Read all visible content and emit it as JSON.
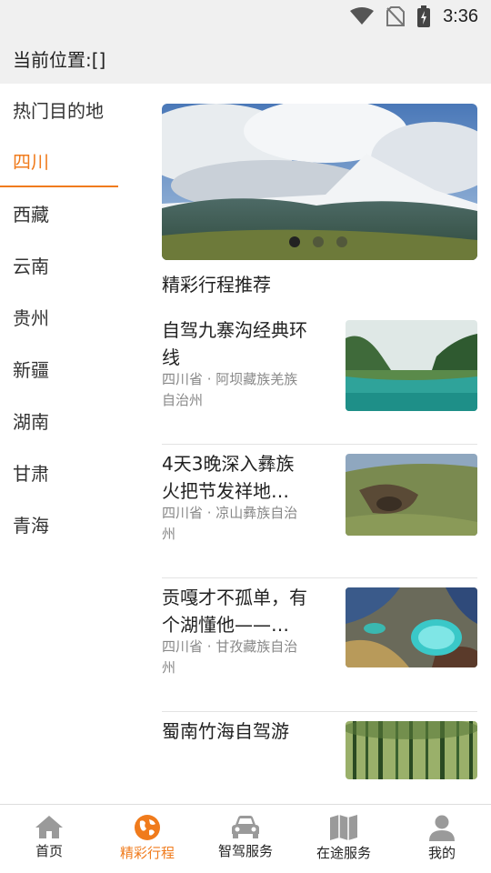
{
  "status_bar": {
    "time": "3:36",
    "icons": [
      "wifi-icon",
      "no-sim-icon",
      "battery-charging-icon"
    ]
  },
  "location_bar": {
    "label": "当前位置:[]"
  },
  "sidebar": {
    "items": [
      {
        "label": "热门目的地",
        "active": false
      },
      {
        "label": "四川",
        "active": true
      },
      {
        "label": "西藏",
        "active": false
      },
      {
        "label": "云南",
        "active": false
      },
      {
        "label": "贵州",
        "active": false
      },
      {
        "label": "新疆",
        "active": false
      },
      {
        "label": "湖南",
        "active": false
      },
      {
        "label": "甘肃",
        "active": false
      },
      {
        "label": "青海",
        "active": false
      }
    ]
  },
  "main": {
    "banner": {
      "image": "snow-mountain-clouds",
      "dots": 3,
      "active_dot": 1
    },
    "section_title": "精彩行程推荐",
    "trips": [
      {
        "title": "自驾九寨沟经典环线",
        "location": "四川省 · 阿坝藏族羌族自治州",
        "image": "jiuzhaigou-lake"
      },
      {
        "title": "4天3晚深入彝族火把节发祥地…",
        "location": "四川省 · 凉山彝族自治州",
        "image": "canyon-grassland"
      },
      {
        "title": "贡嘎才不孤单，有个湖懂他——…",
        "location": "四川省 · 甘孜藏族自治州",
        "image": "turquoise-lake-aerial"
      },
      {
        "title": "蜀南竹海自驾游",
        "location": "",
        "image": "bamboo-forest"
      }
    ]
  },
  "bottom_nav": {
    "items": [
      {
        "label": "首页",
        "icon": "home-icon"
      },
      {
        "label": "精彩行程",
        "icon": "globe-icon"
      },
      {
        "label": "智驾服务",
        "icon": "car-icon"
      },
      {
        "label": "在途服务",
        "icon": "map-icon"
      },
      {
        "label": "我的",
        "icon": "user-icon"
      }
    ],
    "active_index": 1
  },
  "colors": {
    "accent": "#f07b1c",
    "bar_bg": "#f0f0f0",
    "text": "#222222",
    "subtext": "#888888"
  }
}
